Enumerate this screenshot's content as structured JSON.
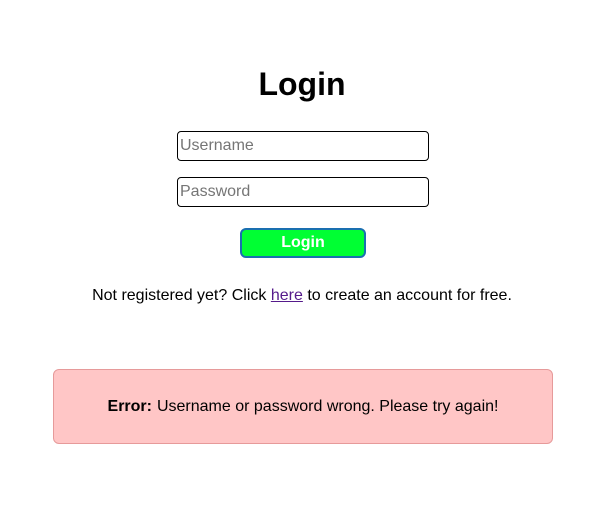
{
  "login": {
    "title": "Login",
    "username_placeholder": "Username",
    "password_placeholder": "Password",
    "button_label": "Login"
  },
  "register": {
    "prefix": "Not registered yet? Click",
    "link_text": "here",
    "suffix": "to create an account for free."
  },
  "error": {
    "label": "Error:",
    "message": "Username or password wrong. Please try again!"
  },
  "colors": {
    "button_bg": "#00ff33",
    "button_border": "#1a6fb0",
    "error_bg": "#ffc6c6",
    "link": "#551a8b"
  }
}
